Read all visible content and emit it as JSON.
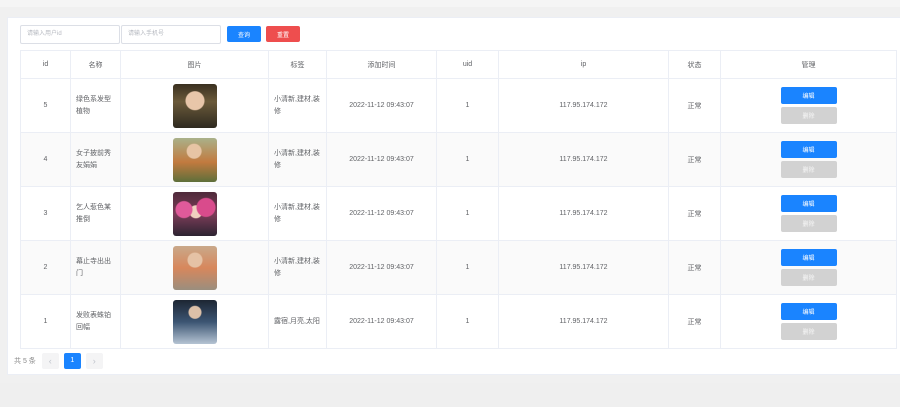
{
  "filters": {
    "user_id_placeholder": "请输入用户id",
    "phone_placeholder": "请输入手机号",
    "search_label": "查询",
    "reset_label": "重置"
  },
  "table": {
    "columns": [
      "id",
      "名称",
      "图片",
      "标签",
      "添加时间",
      "uid",
      "ip",
      "状态",
      "管理"
    ],
    "rows": [
      {
        "id": "5",
        "name": "绿色系发型植物",
        "tags": "小清新,建材,装修",
        "time": "2022-11-12 09:43:07",
        "uid": "1",
        "ip": "117.95.174.172",
        "status": "正常",
        "image": "photo-woman-autumn"
      },
      {
        "id": "4",
        "name": "女子披前秀友娟娟",
        "tags": "小清新,建材,装修",
        "time": "2022-11-12 09:43:07",
        "uid": "1",
        "ip": "117.95.174.172",
        "status": "正常",
        "image": "photo-woman-orange-dress"
      },
      {
        "id": "3",
        "name": "乞人惹色某推倒",
        "tags": "小清新,建材,装修",
        "time": "2022-11-12 09:43:07",
        "uid": "1",
        "ip": "117.95.174.172",
        "status": "正常",
        "image": "photo-woman-pink-flowers"
      },
      {
        "id": "2",
        "name": "幕止寺出出门",
        "tags": "小清新,建材,装修",
        "time": "2022-11-12 09:43:07",
        "uid": "1",
        "ip": "117.95.174.172",
        "status": "正常",
        "image": "photo-woman-orange-top"
      },
      {
        "id": "1",
        "name": "发败表蛛铂回幅",
        "tags": "露宿,月亮,太阳",
        "time": "2022-11-12 09:43:07",
        "uid": "1",
        "ip": "117.95.174.172",
        "status": "正常",
        "image": "photo-woman-stairs"
      }
    ],
    "edit_label": "编辑",
    "delete_label": "删除"
  },
  "pagination": {
    "total_text": "共 5 条",
    "current_page": "1",
    "prev_icon": "chevron-left-icon",
    "next_icon": "chevron-right-icon"
  },
  "colors": {
    "primary": "#1a84ff",
    "danger": "#ee4e4e",
    "disabled": "#d2d2d2"
  }
}
